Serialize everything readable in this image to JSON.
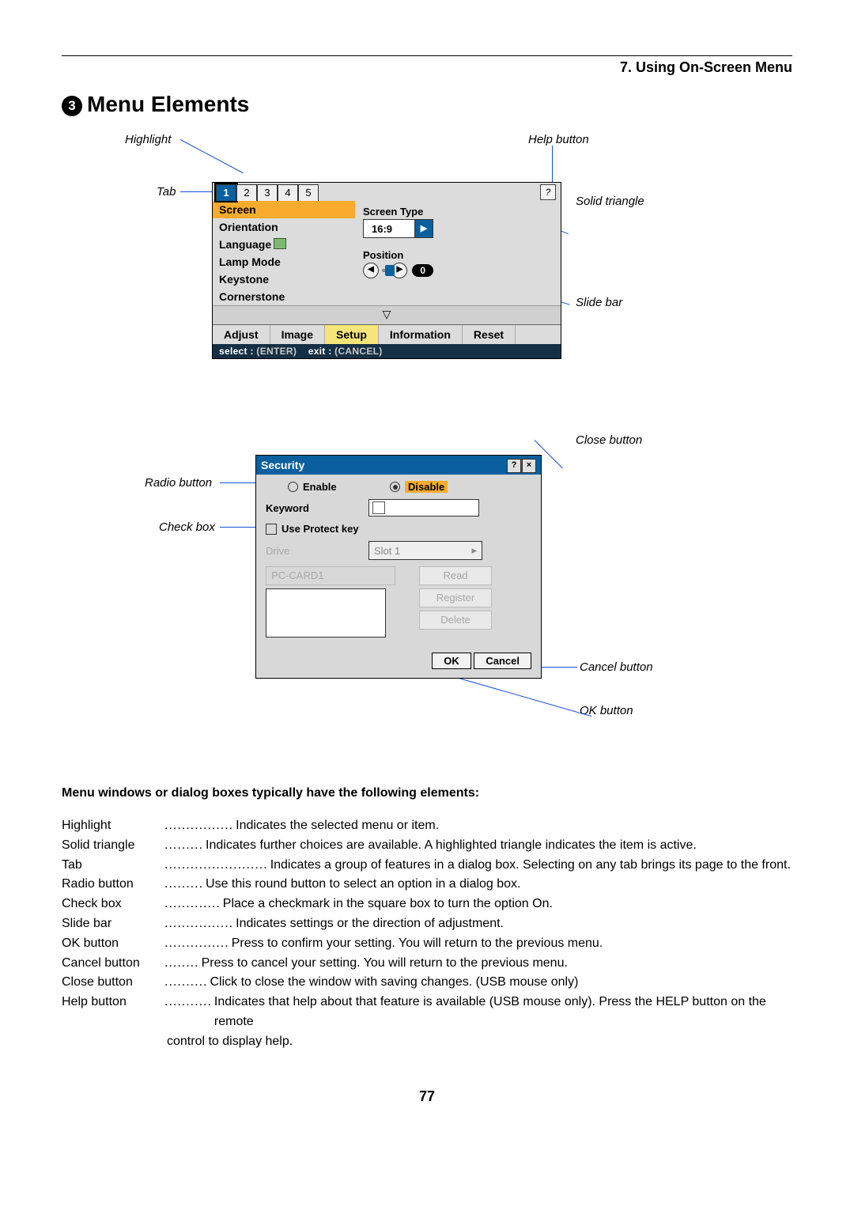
{
  "header": {
    "chapter": "7. Using On-Screen Menu"
  },
  "section": {
    "number": "3",
    "title": "Menu Elements"
  },
  "diagram1": {
    "labels": {
      "highlight": "Highlight",
      "help_button": "Help button",
      "tab": "Tab",
      "solid_triangle": "Solid triangle",
      "slide_bar": "Slide bar"
    },
    "tabs": [
      "1",
      "2",
      "3",
      "4",
      "5"
    ],
    "help_icon": "?",
    "left_items": [
      "Screen",
      "Orientation",
      "Language",
      "Lamp Mode",
      "Keystone",
      "Cornerstone"
    ],
    "screen_type_label": "Screen Type",
    "screen_type_value": "16:9",
    "position_label": "Position",
    "position_value": "0",
    "chevron": "▽",
    "bottom_tabs": [
      "Adjust",
      "Image",
      "Setup",
      "Information",
      "Reset"
    ],
    "footer_select": "select :",
    "footer_enter": "ENTER",
    "footer_exit": "exit :",
    "footer_cancel": "CANCEL"
  },
  "diagram2": {
    "labels": {
      "close_button": "Close button",
      "radio_button": "Radio button",
      "check_box": "Check box",
      "cancel_button": "Cancel button",
      "ok_button": "OK button"
    },
    "title": "Security",
    "enable": "Enable",
    "disable": "Disable",
    "keyword": "Keyword",
    "use_protect": "Use Protect key",
    "drive": "Drive",
    "drive_val": "Slot 1",
    "pc_card": "PC-CARD1",
    "read": "Read",
    "register": "Register",
    "delete": "Delete",
    "ok": "OK",
    "cancel": "Cancel"
  },
  "definitions": {
    "heading": "Menu windows or dialog boxes typically have the following elements:",
    "rows": [
      {
        "term": "Highlight",
        "dots": "................",
        "text": "Indicates the selected menu or item."
      },
      {
        "term": "Solid triangle",
        "dots": ".........",
        "text": "Indicates further choices are available. A highlighted triangle indicates the item is active."
      },
      {
        "term": "Tab",
        "dots": "........................",
        "text": "Indicates a group of features in a dialog box. Selecting on any tab brings its page to the front."
      },
      {
        "term": "Radio button",
        "dots": ".........",
        "text": "Use this round button to select an option in a dialog box."
      },
      {
        "term": "Check box",
        "dots": ".............",
        "text": "Place a checkmark in the square box to turn the option On."
      },
      {
        "term": "Slide bar",
        "dots": "................",
        "text": "Indicates settings or the direction of adjustment."
      },
      {
        "term": "OK button",
        "dots": "...............",
        "text": "Press to confirm your setting. You will return to the previous menu."
      },
      {
        "term": "Cancel button",
        "dots": "........",
        "text": "Press to cancel your setting. You will return to the previous menu."
      },
      {
        "term": "Close button",
        "dots": "..........",
        "text": "Click to close the window with saving changes. (USB mouse only)"
      },
      {
        "term": "Help button",
        "dots": "...........",
        "text": "Indicates that help about that feature is available (USB mouse only). Press the HELP button on the remote"
      }
    ],
    "help_cont": "control to display help."
  },
  "page_number": "77"
}
